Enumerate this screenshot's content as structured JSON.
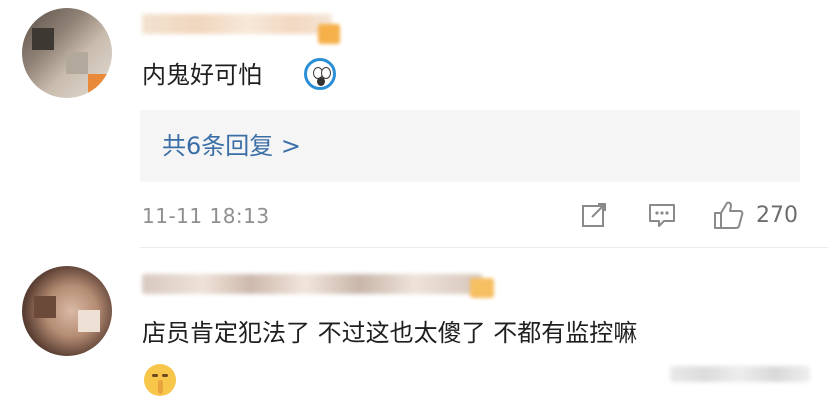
{
  "comments": [
    {
      "text": "内鬼好可怕",
      "emoji": "doraemon-emoji",
      "replies_label": "共6条回复 >",
      "timestamp": "11-11 18:13",
      "like_count": "270",
      "actions": [
        "repost-icon",
        "comment-icon",
        "like-icon"
      ]
    },
    {
      "text": "店员肯定犯法了   不过这也太傻了   不都有监控嘛",
      "emoji": "shushing-face-emoji"
    }
  ],
  "colors": {
    "link": "#3b6ea7",
    "meta": "#8f8f8f",
    "reply_box_bg": "#f5f5f5"
  }
}
